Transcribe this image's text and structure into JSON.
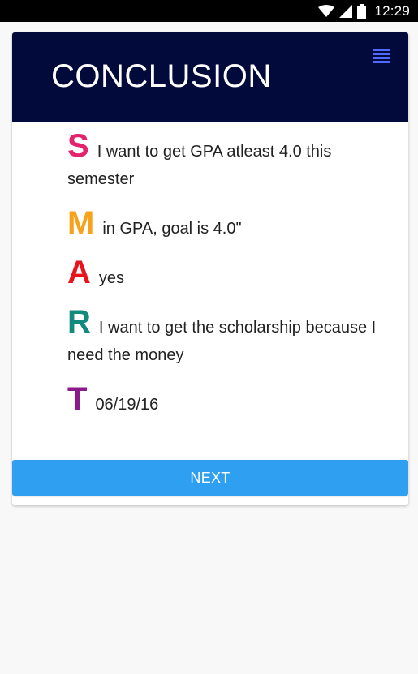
{
  "status_bar": {
    "time": "12:29",
    "icons": [
      "wifi-icon",
      "signal-icon",
      "battery-icon"
    ]
  },
  "header": {
    "title": "CONCLUSION",
    "menu_icon": "hamburger-menu-icon",
    "background_color": "#010a3a",
    "menu_icon_color": "#4f6bff"
  },
  "smart": [
    {
      "letter": "S",
      "text": "I want to get GPA atleast 4.0 this semester",
      "color": "#e3236c"
    },
    {
      "letter": "M",
      "text": "in GPA, goal is 4.0\"",
      "color": "#f7a21b"
    },
    {
      "letter": "A",
      "text": "yes",
      "color": "#e8141c"
    },
    {
      "letter": "R",
      "text": "I want to get the scholarship because I need the money",
      "color": "#138a7e"
    },
    {
      "letter": "T",
      "text": "06/19/16",
      "color": "#8b1a8b"
    }
  ],
  "next_button": {
    "label": "NEXT",
    "color": "#2f9ff2"
  }
}
